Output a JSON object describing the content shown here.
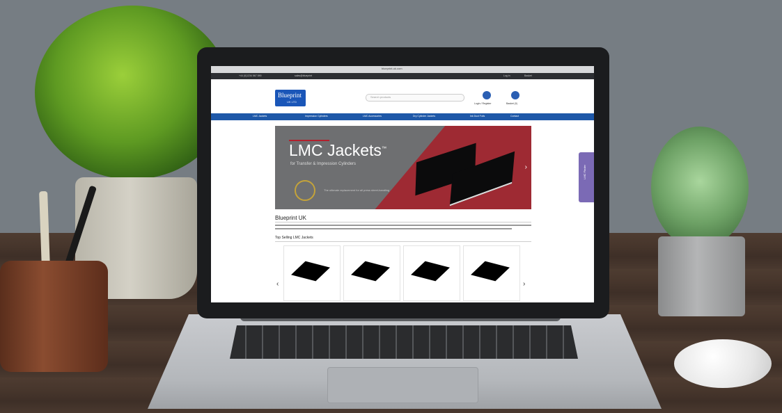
{
  "browser": {
    "tab_title": "blueprint-uk.com"
  },
  "topbar": {
    "phone": "+44 (0)1234 567 890",
    "email": "sales@blueprint",
    "login": "Log in",
    "cart": "Basket"
  },
  "header": {
    "logo_text": "Blueprint",
    "logo_sub": "UK LTD",
    "search_placeholder": "Search products",
    "login_label": "Login / Register",
    "basket_label": "Basket (0)"
  },
  "nav": {
    "items": [
      "LMC Jackets",
      "Impression Cylinders",
      "LMC Accessories",
      "Dry Cylinder Jackets",
      "Ink Duct Foils",
      "Contact"
    ]
  },
  "banner": {
    "title": "LMC Jackets",
    "trademark": "™",
    "subtitle": "for Transfer & Impression Cylinders",
    "tagline": "The ultimate replacement for all press sheet-handling"
  },
  "content": {
    "section_title": "Blueprint UK",
    "subsection_title": "Top Selling LMC Jackets"
  },
  "side_tab": {
    "label": "LMC Finder"
  },
  "colors": {
    "brand_blue": "#1e58a8",
    "banner_red": "#9e2a33",
    "side_tab": "#7b6ab5"
  },
  "carousel": {
    "count": 4,
    "prev": "‹",
    "next": "›"
  }
}
